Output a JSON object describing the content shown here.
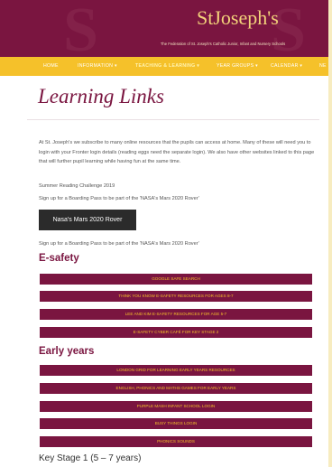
{
  "header": {
    "logo_text": "StJoseph's",
    "logo_subtitle": "The Federation of St. Joseph's Catholic Junior, Infant and Nursery Schools"
  },
  "nav": {
    "items": [
      "HOME",
      "INFORMATION ▾",
      "TEACHING & LEARNING ▾",
      "YEAR GROUPS ▾",
      "CALENDAR ▾",
      "NE"
    ]
  },
  "page": {
    "title": "Learning Links",
    "intro": "At St. Joseph's we subscribe to many online resources that the pupils can access at home. Many of these will need you to login with your Fronter login details (reading eggs need the separate login). We also have other websites linked to this page that will further pupil learning while having fun at the same time.",
    "summer_reading": "Summer Reading Challenge 2019",
    "boarding_pass_1": "Sign up for a Boarding Pass to be part of the 'NASA's Mars 2020 Rover'",
    "mars_button": "Nasa's Mars 2020 Rover",
    "boarding_pass_2": "Sign up for a Boarding Pass to be part of the 'NASA's Mars 2020 Rover'"
  },
  "esafety": {
    "heading": "E-safety",
    "links": [
      "GOOGLE SAFE SEARCH",
      "THINK YOU KNOW E-SAFETY RESOURCES FOR AGES 8-7",
      "LEE AND KIM E-SAFETY RESOURCES FOR AGE 5-7",
      "E-SAFETY CYBER CAFÉ FOR KEY STAGE 2"
    ]
  },
  "early_years": {
    "heading": "Early years",
    "links": [
      "LONDON GRID FOR LEARNING EARLY YEARS RESOURCES",
      "ENGLISH, PHONICS AND MATHS GAMES FOR EARLY YEARS",
      "PURPLE MASH INFANT SCHOOL LOGIN",
      "BUSY THINGS LOGIN",
      "PHONICS SOUNDS"
    ]
  },
  "key_stage_1": {
    "heading": "Key Stage 1 (5 – 7 years)"
  }
}
